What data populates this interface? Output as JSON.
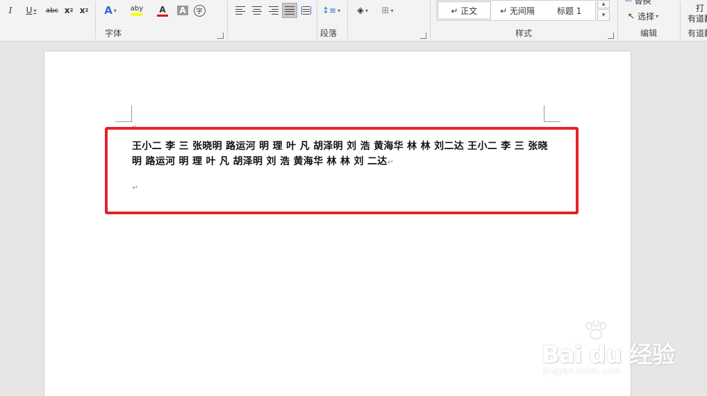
{
  "ribbon": {
    "font_group": {
      "label": "字体",
      "buttons": {
        "italic": "I",
        "underline": "U",
        "strikethrough": "abc",
        "subscript": "x",
        "superscript": "x",
        "text_effect": "A",
        "highlight": "aby",
        "font_color": "A",
        "char_shading": "A",
        "enclose_char": "字"
      }
    },
    "paragraph_group": {
      "label": "段落"
    },
    "styles_group": {
      "label": "样式",
      "items": [
        "↵ 正文",
        "↵ 无间隔",
        "标题 1"
      ]
    },
    "editing_group": {
      "label": "编辑",
      "replace": "替换",
      "select": "选择"
    },
    "youdao_group": {
      "label": "有道翻",
      "top": "打",
      "mid": "有道翻"
    }
  },
  "document": {
    "paragraph": "王小二 李 三 张晓明 路运河 明 理 叶 凡 胡泽明 刘 浩 黄海华 林 林 刘二达 王小二 李 三 张晓明 路运河 明 理 叶 凡 胡泽明 刘 浩 黄海华 林 林 刘 二达",
    "para_mark": "↵",
    "empty_para_mark": "↵"
  },
  "watermark": {
    "brand": "Bai du 经验",
    "url": "jingyan.baidu.com"
  },
  "colors": {
    "highlight_border": "#e62128",
    "font_color_bar": "#e60012",
    "highlight_bar": "#ffff00"
  }
}
